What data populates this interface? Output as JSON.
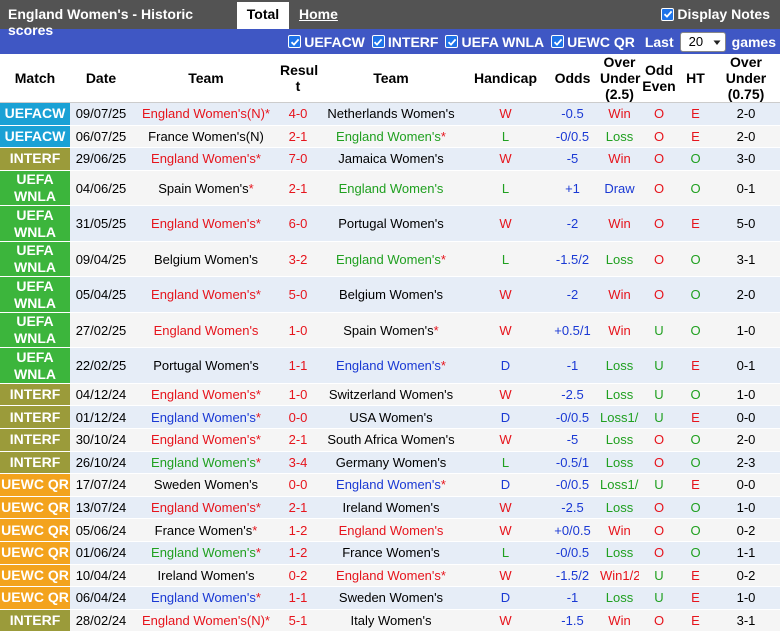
{
  "header": {
    "title": "England Women's - Historic scores",
    "tab_total": "Total",
    "tab_home": "Home",
    "display_notes": "Display Notes"
  },
  "filters": {
    "items": [
      "UEFACW",
      "INTERF",
      "UEFA WNLA",
      "UEWC QR"
    ],
    "last_label": "Last",
    "last_value": "20",
    "games_label": "games"
  },
  "columns": [
    "Match",
    "Date",
    "Team",
    "Resul t",
    "Team",
    "Handicap",
    "Odds",
    "Over Under (2.5)",
    "Odd Even",
    "HT",
    "Over Under (0.75)"
  ],
  "colors": {
    "UEFACW": "#1aa1d5",
    "INTERF": "#9b9b3a",
    "UEFA WNLA": "#3cb53c",
    "UEWC QR": "#f3a31d",
    "win": "#e6141c",
    "loss": "#20a020",
    "draw": "#1a39d4"
  },
  "rows": [
    {
      "comp": "UEFACW",
      "cc": "c-uefacw",
      "date": "09/07/25",
      "home": "England Women's(N)",
      "home_star": "*",
      "hc": "red",
      "score": "4-0",
      "away": "Netherlands Women's",
      "away_star": "",
      "ac": "neutral",
      "res": "W",
      "rc": "red",
      "hcap": "-0.5",
      "odds": "Win",
      "oc": "red",
      "ou": "O",
      "uc": "red",
      "oe": "E",
      "ec": "red",
      "ht": "2-0",
      "ou2": "O",
      "u2c": "red"
    },
    {
      "comp": "UEFACW",
      "cc": "c-uefacw",
      "date": "06/07/25",
      "home": "France Women's(N)",
      "home_star": "",
      "hc": "neutral",
      "score": "2-1",
      "away": "England Women's",
      "away_star": "*",
      "ac": "green",
      "res": "L",
      "rc": "green",
      "hcap": "-0/0.5",
      "odds": "Loss",
      "oc": "green",
      "ou": "O",
      "uc": "red",
      "oe": "E",
      "ec": "red",
      "ht": "2-0",
      "ou2": "O",
      "u2c": "red"
    },
    {
      "comp": "INTERF",
      "cc": "c-interf",
      "date": "29/06/25",
      "home": "England Women's",
      "home_star": "*",
      "hc": "red",
      "score": "7-0",
      "away": "Jamaica Women's",
      "away_star": "",
      "ac": "neutral",
      "res": "W",
      "rc": "red",
      "hcap": "-5",
      "odds": "Win",
      "oc": "red",
      "ou": "O",
      "uc": "red",
      "oe": "O",
      "ec": "green",
      "ht": "3-0",
      "ou2": "O",
      "u2c": "red"
    },
    {
      "comp": "UEFA WNLA",
      "cc": "c-wnla",
      "tall": true,
      "date": "04/06/25",
      "home": "Spain Women's",
      "home_star": "*",
      "hc": "neutral",
      "score": "2-1",
      "away": "England Women's",
      "away_star": "",
      "ac": "green",
      "res": "L",
      "rc": "green",
      "hcap": "+1",
      "odds": "Draw",
      "oc": "blue",
      "ou": "O",
      "uc": "red",
      "oe": "O",
      "ec": "green",
      "ht": "0-1",
      "ou2": "O",
      "u2c": "red"
    },
    {
      "comp": "UEFA WNLA",
      "cc": "c-wnla",
      "tall": true,
      "date": "31/05/25",
      "home": "England Women's",
      "home_star": "*",
      "hc": "red",
      "score": "6-0",
      "away": "Portugal Women's",
      "away_star": "",
      "ac": "neutral",
      "res": "W",
      "rc": "red",
      "hcap": "-2",
      "odds": "Win",
      "oc": "red",
      "ou": "O",
      "uc": "red",
      "oe": "E",
      "ec": "red",
      "ht": "5-0",
      "ou2": "O",
      "u2c": "red"
    },
    {
      "comp": "UEFA WNLA",
      "cc": "c-wnla",
      "tall": true,
      "date": "09/04/25",
      "home": "Belgium Women's",
      "home_star": "",
      "hc": "neutral",
      "score": "3-2",
      "away": "England Women's",
      "away_star": "*",
      "ac": "green",
      "res": "L",
      "rc": "green",
      "hcap": "-1.5/2",
      "odds": "Loss",
      "oc": "green",
      "ou": "O",
      "uc": "red",
      "oe": "O",
      "ec": "green",
      "ht": "3-1",
      "ou2": "O",
      "u2c": "red"
    },
    {
      "comp": "UEFA WNLA",
      "cc": "c-wnla",
      "tall": true,
      "date": "05/04/25",
      "home": "England Women's",
      "home_star": "*",
      "hc": "red",
      "score": "5-0",
      "away": "Belgium Women's",
      "away_star": "",
      "ac": "neutral",
      "res": "W",
      "rc": "red",
      "hcap": "-2",
      "odds": "Win",
      "oc": "red",
      "ou": "O",
      "uc": "red",
      "oe": "O",
      "ec": "green",
      "ht": "2-0",
      "ou2": "O",
      "u2c": "red"
    },
    {
      "comp": "UEFA WNLA",
      "cc": "c-wnla",
      "tall": true,
      "date": "27/02/25",
      "home": "England Women's",
      "home_star": "",
      "hc": "red",
      "score": "1-0",
      "away": "Spain Women's",
      "away_star": "*",
      "ac": "neutral",
      "res": "W",
      "rc": "red",
      "hcap": "+0.5/1",
      "odds": "Win",
      "oc": "red",
      "ou": "U",
      "uc": "green",
      "oe": "O",
      "ec": "green",
      "ht": "1-0",
      "ou2": "O",
      "u2c": "red"
    },
    {
      "comp": "UEFA WNLA",
      "cc": "c-wnla",
      "tall": true,
      "date": "22/02/25",
      "home": "Portugal Women's",
      "home_star": "",
      "hc": "neutral",
      "score": "1-1",
      "away": "England Women's",
      "away_star": "*",
      "ac": "blue",
      "res": "D",
      "rc": "blue",
      "hcap": "-1",
      "odds": "Loss",
      "oc": "green",
      "ou": "U",
      "uc": "green",
      "oe": "E",
      "ec": "red",
      "ht": "0-1",
      "ou2": "O",
      "u2c": "red"
    },
    {
      "comp": "INTERF",
      "cc": "c-interf",
      "date": "04/12/24",
      "home": "England Women's",
      "home_star": "*",
      "hc": "red",
      "score": "1-0",
      "away": "Switzerland Women's",
      "away_star": "",
      "ac": "neutral",
      "res": "W",
      "rc": "red",
      "hcap": "-2.5",
      "odds": "Loss",
      "oc": "green",
      "ou": "U",
      "uc": "green",
      "oe": "O",
      "ec": "green",
      "ht": "1-0",
      "ou2": "O",
      "u2c": "red"
    },
    {
      "comp": "INTERF",
      "cc": "c-interf",
      "date": "01/12/24",
      "home": "England Women's",
      "home_star": "*",
      "hc": "blue",
      "score": "0-0",
      "away": "USA Women's",
      "away_star": "",
      "ac": "neutral",
      "res": "D",
      "rc": "blue",
      "hcap": "-0/0.5",
      "odds": "Loss1/2",
      "oc": "green",
      "ou": "U",
      "uc": "green",
      "oe": "E",
      "ec": "red",
      "ht": "0-0",
      "ou2": "U",
      "u2c": "green"
    },
    {
      "comp": "INTERF",
      "cc": "c-interf",
      "date": "30/10/24",
      "home": "England Women's",
      "home_star": "*",
      "hc": "red",
      "score": "2-1",
      "away": "South Africa Women's",
      "away_star": "",
      "ac": "neutral",
      "res": "W",
      "rc": "red",
      "hcap": "-5",
      "odds": "Loss",
      "oc": "green",
      "ou": "O",
      "uc": "red",
      "oe": "O",
      "ec": "green",
      "ht": "2-0",
      "ou2": "O",
      "u2c": "red"
    },
    {
      "comp": "INTERF",
      "cc": "c-interf",
      "date": "26/10/24",
      "home": "England Women's",
      "home_star": "*",
      "hc": "green",
      "score": "3-4",
      "away": "Germany Women's",
      "away_star": "",
      "ac": "neutral",
      "res": "L",
      "rc": "green",
      "hcap": "-0.5/1",
      "odds": "Loss",
      "oc": "green",
      "ou": "O",
      "uc": "red",
      "oe": "O",
      "ec": "green",
      "ht": "2-3",
      "ou2": "O",
      "u2c": "red"
    },
    {
      "comp": "UEWC QR",
      "cc": "c-uewc",
      "date": "17/07/24",
      "home": "Sweden Women's",
      "home_star": "",
      "hc": "neutral",
      "score": "0-0",
      "away": "England Women's",
      "away_star": "*",
      "ac": "blue",
      "res": "D",
      "rc": "blue",
      "hcap": "-0/0.5",
      "odds": "Loss1/2",
      "oc": "green",
      "ou": "U",
      "uc": "green",
      "oe": "E",
      "ec": "red",
      "ht": "0-0",
      "ou2": "U",
      "u2c": "green"
    },
    {
      "comp": "UEWC QR",
      "cc": "c-uewc",
      "date": "13/07/24",
      "home": "England Women's",
      "home_star": "*",
      "hc": "red",
      "score": "2-1",
      "away": "Ireland Women's",
      "away_star": "",
      "ac": "neutral",
      "res": "W",
      "rc": "red",
      "hcap": "-2.5",
      "odds": "Loss",
      "oc": "green",
      "ou": "O",
      "uc": "red",
      "oe": "O",
      "ec": "green",
      "ht": "1-0",
      "ou2": "O",
      "u2c": "red"
    },
    {
      "comp": "UEWC QR",
      "cc": "c-uewc",
      "date": "05/06/24",
      "home": "France Women's",
      "home_star": "*",
      "hc": "neutral",
      "score": "1-2",
      "away": "England Women's",
      "away_star": "",
      "ac": "red",
      "res": "W",
      "rc": "red",
      "hcap": "+0/0.5",
      "odds": "Win",
      "oc": "red",
      "ou": "O",
      "uc": "red",
      "oe": "O",
      "ec": "green",
      "ht": "0-2",
      "ou2": "O",
      "u2c": "red"
    },
    {
      "comp": "UEWC QR",
      "cc": "c-uewc",
      "date": "01/06/24",
      "home": "England Women's",
      "home_star": "*",
      "hc": "green",
      "score": "1-2",
      "away": "France Women's",
      "away_star": "",
      "ac": "neutral",
      "res": "L",
      "rc": "green",
      "hcap": "-0/0.5",
      "odds": "Loss",
      "oc": "green",
      "ou": "O",
      "uc": "red",
      "oe": "O",
      "ec": "green",
      "ht": "1-1",
      "ou2": "O",
      "u2c": "red"
    },
    {
      "comp": "UEWC QR",
      "cc": "c-uewc",
      "date": "10/04/24",
      "home": "Ireland Women's",
      "home_star": "",
      "hc": "neutral",
      "score": "0-2",
      "away": "England Women's",
      "away_star": "*",
      "ac": "red",
      "res": "W",
      "rc": "red",
      "hcap": "-1.5/2",
      "odds": "Win1/2",
      "oc": "red",
      "ou": "U",
      "uc": "green",
      "oe": "E",
      "ec": "red",
      "ht": "0-2",
      "ou2": "O",
      "u2c": "red"
    },
    {
      "comp": "UEWC QR",
      "cc": "c-uewc",
      "date": "06/04/24",
      "home": "England Women's",
      "home_star": "*",
      "hc": "blue",
      "score": "1-1",
      "away": "Sweden Women's",
      "away_star": "",
      "ac": "neutral",
      "res": "D",
      "rc": "blue",
      "hcap": "-1",
      "odds": "Loss",
      "oc": "green",
      "ou": "U",
      "uc": "green",
      "oe": "E",
      "ec": "red",
      "ht": "1-0",
      "ou2": "O",
      "u2c": "red"
    },
    {
      "comp": "INTERF",
      "cc": "c-interf",
      "date": "28/02/24",
      "home": "England Women's(N)",
      "home_star": "*",
      "hc": "red",
      "score": "5-1",
      "away": "Italy Women's",
      "away_star": "",
      "ac": "neutral",
      "res": "W",
      "rc": "red",
      "hcap": "-1.5",
      "odds": "Win",
      "oc": "red",
      "ou": "O",
      "uc": "red",
      "oe": "E",
      "ec": "red",
      "ht": "3-1",
      "ou2": "O",
      "u2c": "red"
    }
  ]
}
